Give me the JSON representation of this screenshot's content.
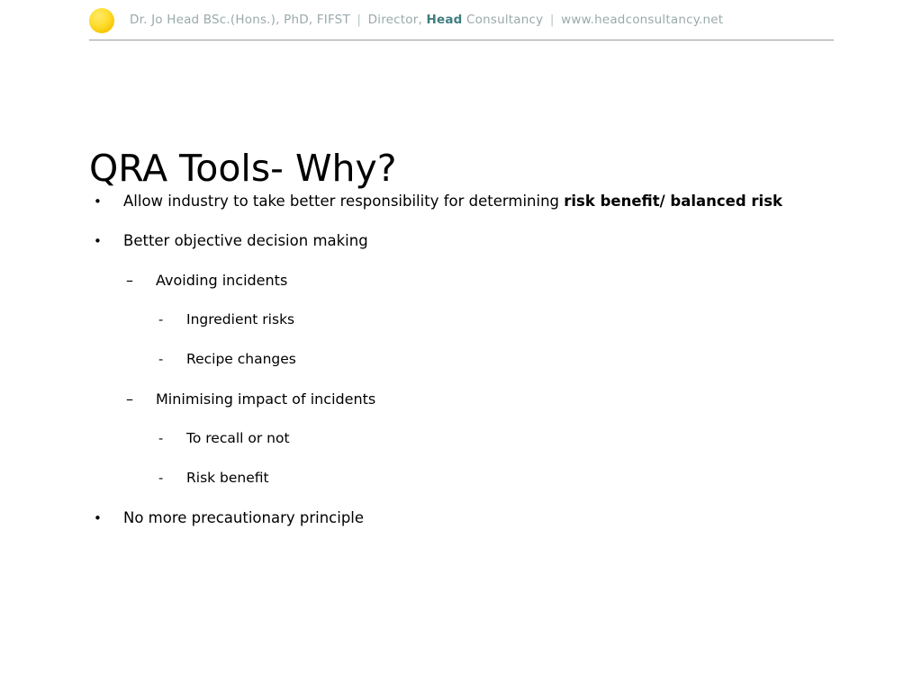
{
  "header": {
    "logo_icon": "gold-circle-logo",
    "name_credentials": "Dr. Jo Head BSc.(Hons.), PhD, FIFST",
    "separator": "|",
    "role_prefix": "Director,",
    "brand": "Head",
    "brand_suffix": "Consultancy",
    "website": "www.headconsultancy.net",
    "text_color": "#9aa9ab",
    "brand_color": "#3f7d80",
    "rule_color": "#9b9b9b",
    "logo_color": "#ffdd30"
  },
  "slide": {
    "title": "QRA Tools- Why?",
    "bullet_marker": "•",
    "dash_marker": "–",
    "hyphen_marker": "-",
    "items": [
      {
        "level": 1,
        "text_plain": "Allow industry to take better responsibility for determining ",
        "text_bold": "risk benefit/ balanced risk"
      },
      {
        "level": 1,
        "text_plain": "Better objective decision making",
        "text_bold": ""
      },
      {
        "level": 2,
        "text_plain": "Avoiding incidents",
        "text_bold": ""
      },
      {
        "level": 3,
        "text_plain": "Ingredient risks",
        "text_bold": ""
      },
      {
        "level": 3,
        "text_plain": "Recipe changes",
        "text_bold": ""
      },
      {
        "level": 2,
        "text_plain": "Minimising impact of incidents",
        "text_bold": ""
      },
      {
        "level": 3,
        "text_plain": "To recall or not",
        "text_bold": ""
      },
      {
        "level": 3,
        "text_plain": "Risk benefit",
        "text_bold": ""
      },
      {
        "level": 1,
        "text_plain": "No more precautionary principle",
        "text_bold": ""
      }
    ]
  }
}
